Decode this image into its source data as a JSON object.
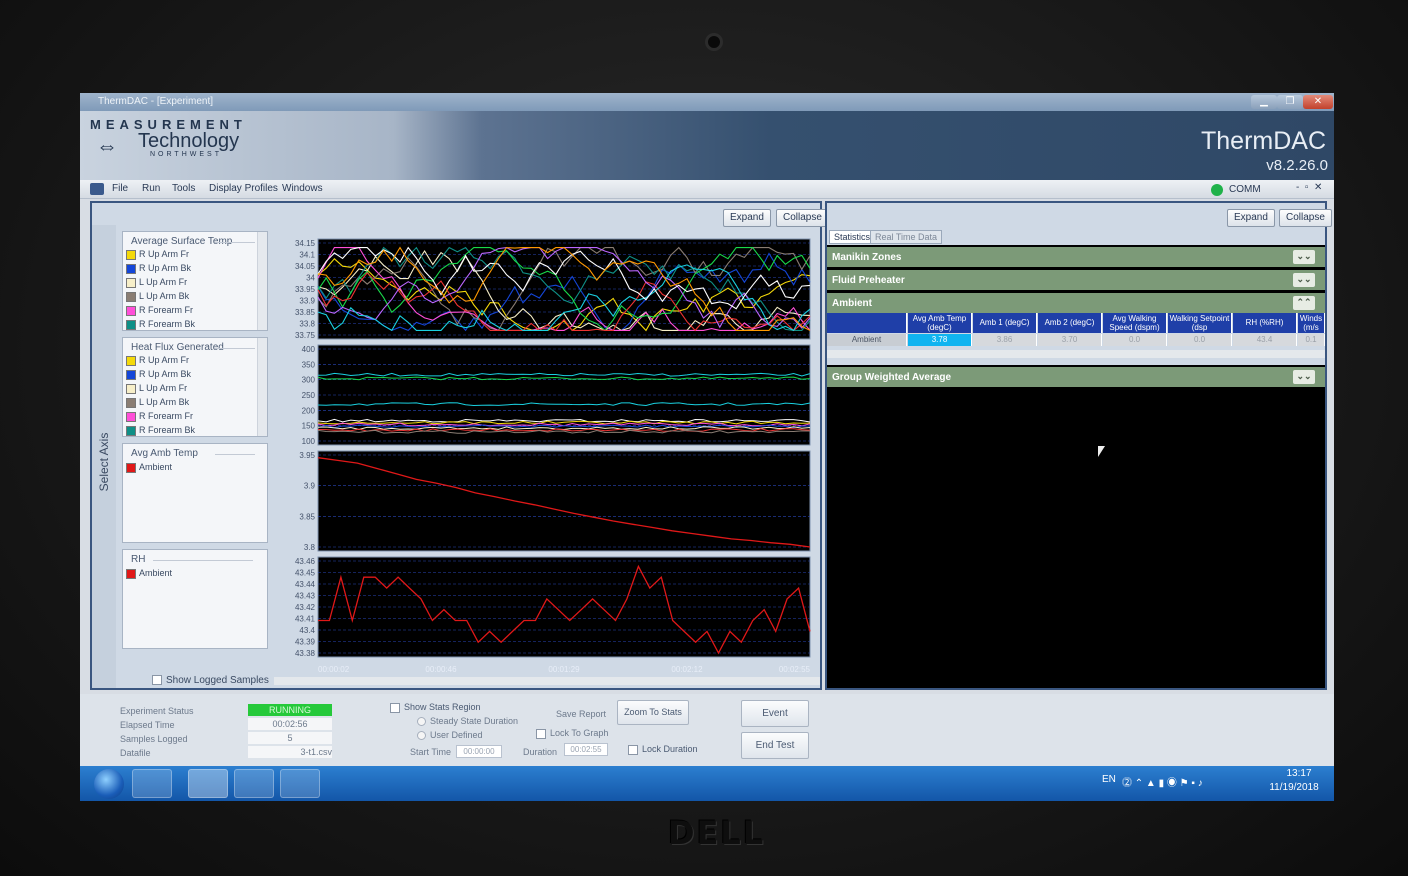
{
  "window": {
    "title": "ThermDAC - [Experiment]",
    "app_name": "ThermDAC",
    "version": "v8.2.26.0",
    "logo_line1": "MEASUREMENT",
    "logo_line2": "Technology",
    "logo_line3": "NORTHWEST"
  },
  "menu": {
    "items": [
      "File",
      "Run",
      "Tools",
      "Display Profiles",
      "Windows"
    ],
    "comm_label": "COMM",
    "comm_color": "#1fb24a"
  },
  "left_panel": {
    "select_axis": "Select Axis",
    "expand_label": "Expand",
    "collapse_label": "Collapse",
    "show_logged": "Show Logged Samples",
    "legends": [
      {
        "title": "Average Surface Temp",
        "items": [
          {
            "label": "R Up Arm Fr",
            "color": "#f4d90a"
          },
          {
            "label": "R Up Arm Bk",
            "color": "#1446d8"
          },
          {
            "label": "L Up Arm Fr",
            "color": "#f7efc9"
          },
          {
            "label": "L Up Arm Bk",
            "color": "#8a7d73"
          },
          {
            "label": "R Forearm Fr",
            "color": "#ff4fd8"
          },
          {
            "label": "R Forearm Bk",
            "color": "#0f8f86"
          }
        ]
      },
      {
        "title": "Heat Flux Generated",
        "items": [
          {
            "label": "R Up Arm Fr",
            "color": "#f4d90a"
          },
          {
            "label": "R Up Arm Bk",
            "color": "#1446d8"
          },
          {
            "label": "L Up Arm Fr",
            "color": "#f7efc9"
          },
          {
            "label": "L Up Arm Bk",
            "color": "#8a7d73"
          },
          {
            "label": "R Forearm Fr",
            "color": "#ff4fd8"
          },
          {
            "label": "R Forearm Bk",
            "color": "#0f8f86"
          }
        ]
      },
      {
        "title": "Avg Amb Temp",
        "items": [
          {
            "label": "Ambient",
            "color": "#e01818"
          }
        ]
      },
      {
        "title": "RH",
        "items": [
          {
            "label": "Ambient",
            "color": "#e01818"
          }
        ]
      }
    ]
  },
  "charts": {
    "time_ticks": [
      "00:00:02",
      "00:00:46",
      "00:01:29",
      "00:02:12",
      "00:02:55"
    ],
    "avg_surface_ticks": [
      "34.15",
      "34.1",
      "34.05",
      "34",
      "33.95",
      "33.9",
      "33.85",
      "33.8",
      "33.75"
    ],
    "heat_flux_ticks": [
      "400",
      "350",
      "300",
      "250",
      "200",
      "150",
      "100"
    ],
    "amb_temp_ticks": [
      "3.95",
      "3.9",
      "3.85",
      "3.8"
    ],
    "rh_ticks": [
      "43.46",
      "43.45",
      "43.44",
      "43.43",
      "43.42",
      "43.41",
      "43.4",
      "43.39",
      "43.38"
    ]
  },
  "chart_data": [
    {
      "type": "line",
      "title": "Average Surface Temp",
      "ylim": [
        33.75,
        34.15
      ],
      "series": [
        {
          "name": "R Up Arm Fr",
          "color": "#f4d90a"
        },
        {
          "name": "R Up Arm Bk",
          "color": "#1446d8"
        },
        {
          "name": "L Up Arm Fr",
          "color": "#f7efc9"
        },
        {
          "name": "L Up Arm Bk",
          "color": "#8a7d73"
        },
        {
          "name": "R Forearm Fr",
          "color": "#ff4fd8"
        },
        {
          "name": "R Forearm Bk",
          "color": "#0f8f86"
        }
      ]
    },
    {
      "type": "line",
      "title": "Heat Flux Generated",
      "ylim": [
        100,
        400
      ]
    },
    {
      "type": "line",
      "title": "Avg Amb Temp",
      "series": [
        {
          "name": "Ambient",
          "color": "#e01818",
          "values": [
            3.965,
            3.96,
            3.955,
            3.945,
            3.935,
            3.925,
            3.918,
            3.91,
            3.9,
            3.893,
            3.885,
            3.878,
            3.87,
            3.862,
            3.855,
            3.848,
            3.842,
            3.836,
            3.83,
            3.825,
            3.82,
            3.815,
            3.812,
            3.808,
            3.805,
            3.8
          ]
        }
      ],
      "ylim": [
        3.8,
        3.97
      ]
    },
    {
      "type": "line",
      "title": "RH",
      "series": [
        {
          "name": "Ambient",
          "color": "#e01818",
          "values": [
            43.41,
            43.41,
            43.45,
            43.41,
            43.45,
            43.45,
            43.44,
            43.45,
            43.44,
            43.43,
            43.41,
            43.42,
            43.41,
            43.41,
            43.39,
            43.4,
            43.39,
            43.4,
            43.41,
            43.41,
            43.43,
            43.42,
            43.41,
            43.42,
            43.43,
            43.42,
            43.41,
            43.43,
            43.46,
            43.44,
            43.45,
            43.41,
            43.4,
            43.39,
            43.4,
            43.38,
            43.4,
            43.39,
            43.41,
            43.42,
            43.4,
            43.43,
            43.44,
            43.4
          ]
        }
      ],
      "ylim": [
        43.38,
        43.465
      ]
    }
  ],
  "right_panel": {
    "expand_label": "Expand",
    "collapse_label": "Collapse",
    "tabs": [
      "Statistics",
      "Real Time Data"
    ],
    "sections": [
      "Manikin Zones",
      "Fluid Preheater",
      "Ambient",
      "Group Weighted Average"
    ],
    "section_color": "#7c9a78",
    "ambient_table": {
      "headers": [
        "Avg Amb Temp (degC)",
        "Amb 1 (degC)",
        "Amb 2 (degC)",
        "Avg Walking Speed (dspm)",
        "Walking Setpoint (dsp",
        "RH (%RH)",
        "Winds (m/s"
      ],
      "row_label": "Ambient",
      "values": [
        "3.78",
        "3.86",
        "3.70",
        "0.0",
        "0.0",
        "43.4",
        "0.1"
      ]
    }
  },
  "status": {
    "experiment_status_label": "Experiment Status",
    "experiment_status": "RUNNING",
    "elapsed_label": "Elapsed Time",
    "elapsed": "00:02:56",
    "samples_label": "Samples Logged",
    "samples": "5",
    "datafile_label": "Datafile",
    "datafile": "3-t1.csv",
    "show_stats": "Show Stats Region",
    "steady_state": "Steady State Duration",
    "user_defined": "User Defined",
    "start_time_label": "Start Time",
    "start_time": "00:00:00",
    "save_report": "Save Report",
    "zoom_to_stats": "Zoom To Stats",
    "lock_to_graph": "Lock To Graph",
    "duration_label": "Duration",
    "duration": "00:02:55",
    "lock_duration": "Lock Duration",
    "event": "Event",
    "end_test": "End Test"
  },
  "taskbar": {
    "lang": "EN",
    "time": "13:17",
    "date": "11/19/2018"
  },
  "bezel_brand": "DELL"
}
